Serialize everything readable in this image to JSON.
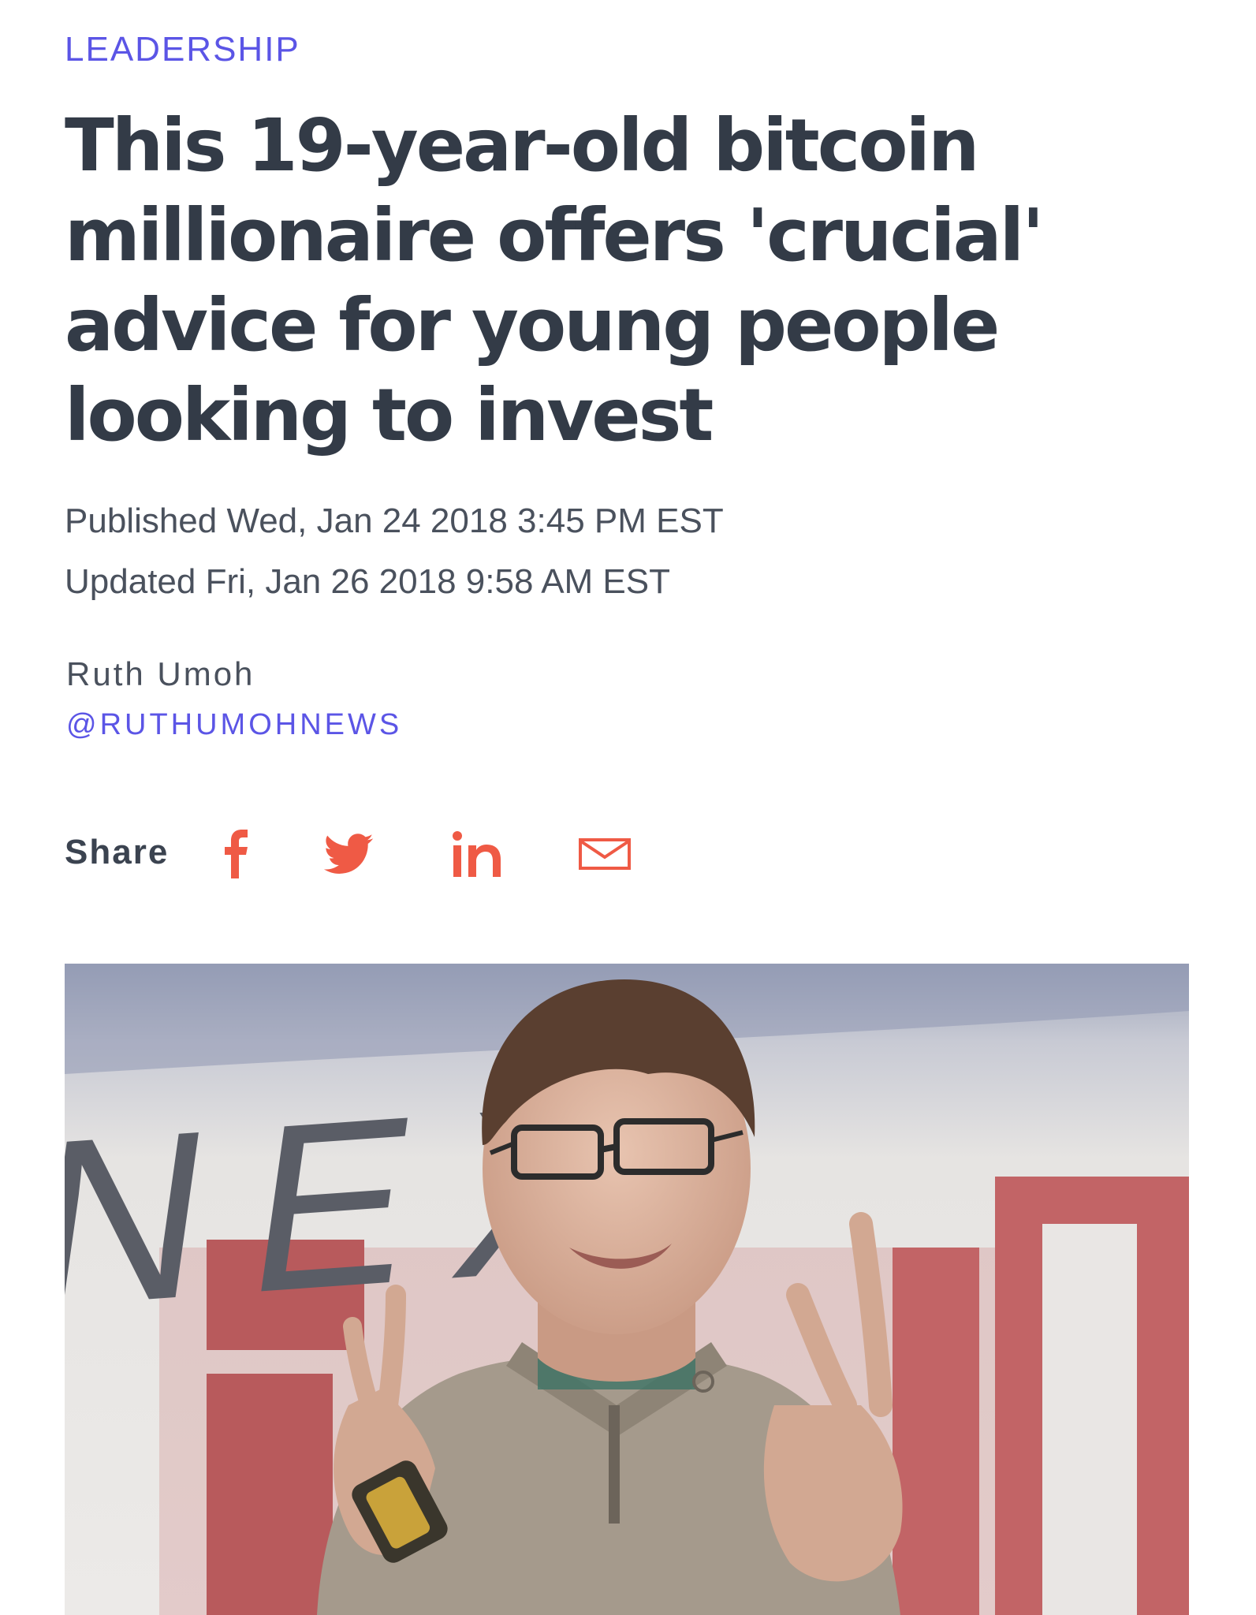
{
  "article": {
    "section": "LEADERSHIP",
    "headline": "This 19-year-old bitcoin millionaire offers 'crucial' advice for young people looking to invest",
    "published": "Published Wed, Jan 24 2018 3:45 PM EST",
    "updated": "Updated Fri, Jan 26 2018 9:58 AM EST",
    "author": {
      "name": "Ruth Umoh",
      "handle": "@RUTHUMOHNEWS"
    }
  },
  "share": {
    "label": "Share",
    "icons": [
      "facebook-icon",
      "twitter-icon",
      "linkedin-icon",
      "mail-icon"
    ],
    "accent_color": "#ef5a45"
  },
  "hero_image": {
    "backdrop_letters": "NEX"
  },
  "colors": {
    "section": "#5b55e6",
    "headline": "#333b47",
    "meta": "#4a515d",
    "share_icons": "#ef5a45"
  }
}
